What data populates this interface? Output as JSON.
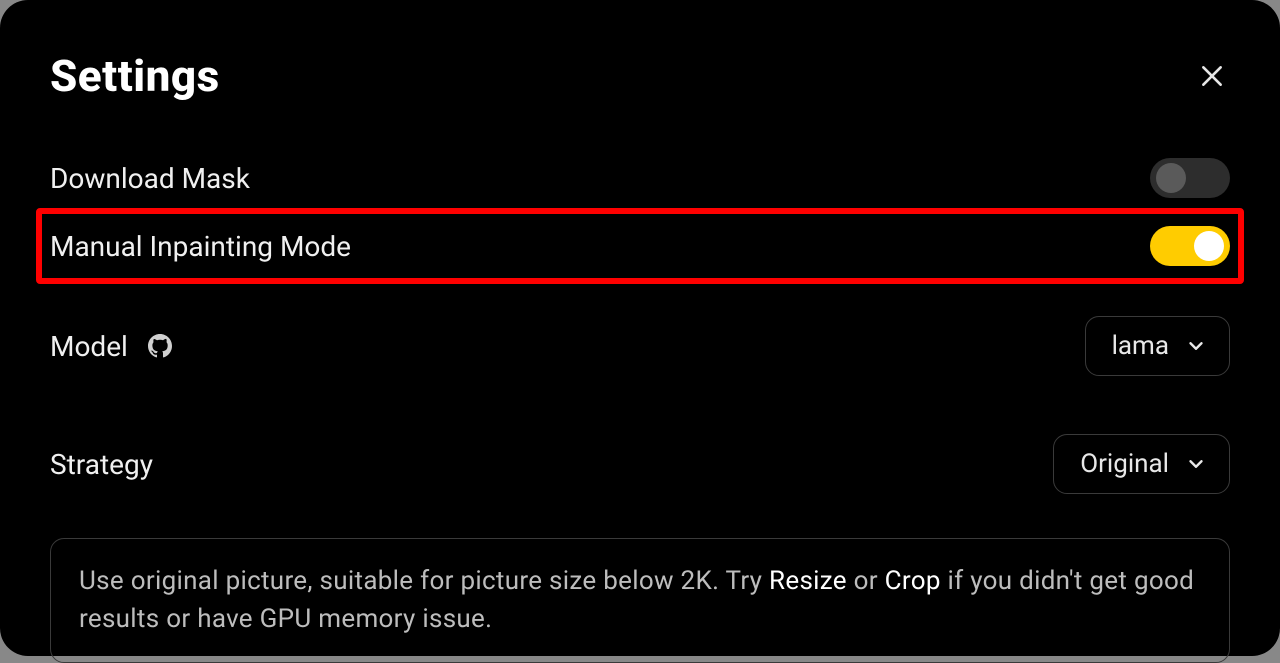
{
  "title": "Settings",
  "close_aria": "Close",
  "rows": {
    "download_mask": {
      "label": "Download Mask",
      "enabled": false
    },
    "manual_inpainting": {
      "label": "Manual Inpainting Mode",
      "enabled": true,
      "highlighted": true
    },
    "model": {
      "label": "Model",
      "value": "lama"
    },
    "strategy": {
      "label": "Strategy",
      "value": "Original"
    }
  },
  "hint": {
    "prefix": "Use original picture, suitable for picture size below 2K. Try ",
    "strong1": "Resize",
    "mid": " or ",
    "strong2": "Crop",
    "suffix": " if you didn't get good results or have GPU memory issue."
  }
}
